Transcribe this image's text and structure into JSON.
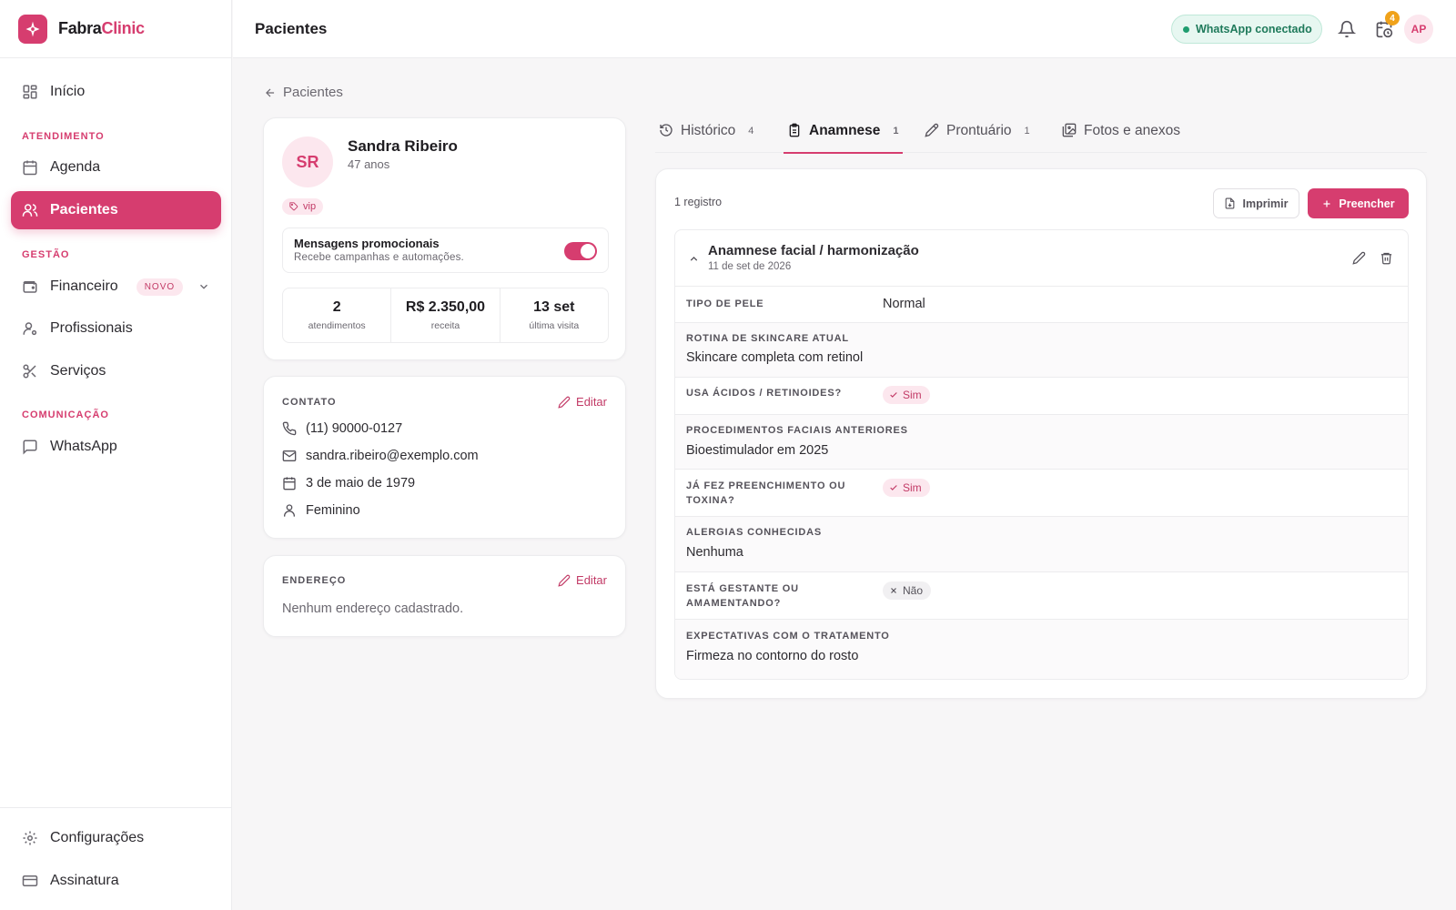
{
  "brand": {
    "name_part1": "Fabra",
    "name_part2": "Clinic",
    "accent": "#d63d6f"
  },
  "sidebar": {
    "home": {
      "label": "Início",
      "icon": "grid-icon"
    },
    "sections": {
      "atendimento": "ATENDIMENTO",
      "gestao": "GESTÃO",
      "comunicacao": "COMUNICAÇÃO"
    },
    "items": [
      {
        "label": "Agenda",
        "icon": "calendar-icon"
      },
      {
        "label": "Pacientes",
        "icon": "users-icon",
        "active": true
      },
      {
        "label": "Financeiro",
        "icon": "wallet-icon",
        "badge": "NOVO"
      },
      {
        "label": "Profissionais",
        "icon": "user-gear-icon"
      },
      {
        "label": "Serviços",
        "icon": "scissors-icon"
      },
      {
        "label": "WhatsApp",
        "icon": "chat-icon"
      }
    ],
    "bottom": [
      {
        "label": "Configurações",
        "icon": "gear-icon"
      },
      {
        "label": "Assinatura",
        "icon": "card-icon"
      }
    ]
  },
  "header": {
    "title": "Pacientes",
    "whatsapp_status": "WhatsApp conectado",
    "notification_count": "4",
    "user_initials": "AP"
  },
  "back_link": "Pacientes",
  "patient": {
    "initials": "SR",
    "name": "Sandra Ribeiro",
    "age": "47 anos",
    "tag": "vip",
    "promo_title": "Mensagens promocionais",
    "promo_subtitle": "Recebe campanhas e automações.",
    "promo_enabled": true,
    "stats": [
      {
        "value": "2",
        "label": "atendimentos"
      },
      {
        "value": "R$ 2.350,00",
        "label": "receita"
      },
      {
        "value": "13 set",
        "label": "última visita"
      }
    ]
  },
  "contact": {
    "label": "CONTATO",
    "edit": "Editar",
    "phone": "(11) 90000-0127",
    "email": "sandra.ribeiro@exemplo.com",
    "birthdate": "3 de maio de 1979",
    "gender": "Feminino"
  },
  "address": {
    "label": "ENDEREÇO",
    "edit": "Editar",
    "empty": "Nenhum endereço cadastrado."
  },
  "tabs": [
    {
      "label": "Histórico",
      "count": "4",
      "icon": "history-icon"
    },
    {
      "label": "Anamnese",
      "count": "1",
      "icon": "clipboard-icon",
      "active": true
    },
    {
      "label": "Prontuário",
      "count": "1",
      "icon": "pen-icon"
    },
    {
      "label": "Fotos e anexos",
      "icon": "images-icon"
    }
  ],
  "anamnese": {
    "count_label": "1 registro",
    "print_label": "Imprimir",
    "fill_label": "Preencher",
    "record": {
      "title": "Anamnese facial / harmonização",
      "date": "11 de set de 2026",
      "rows": [
        {
          "label": "TIPO DE PELE",
          "value": "Normal"
        },
        {
          "label": "ROTINA DE SKINCARE ATUAL",
          "value": "Skincare completa com retinol"
        },
        {
          "label": "USA ÁCIDOS / RETINOIDES?",
          "value": "Sim"
        },
        {
          "label": "PROCEDIMENTOS FACIAIS ANTERIORES",
          "value": "Bioestimulador em 2025"
        },
        {
          "label_line1": "JÁ FEZ PREENCHIMENTO OU",
          "label_line2": "TOXINA?",
          "value": "Sim"
        },
        {
          "label": "ALERGIAS CONHECIDAS",
          "value": "Nenhuma"
        },
        {
          "label_line1": "ESTÁ GESTANTE OU",
          "label_line2": "AMAMENTANDO?",
          "value": "Não"
        },
        {
          "label": "EXPECTATIVAS COM O TRATAMENTO",
          "value": "Firmeza no contorno do rosto"
        }
      ]
    }
  }
}
